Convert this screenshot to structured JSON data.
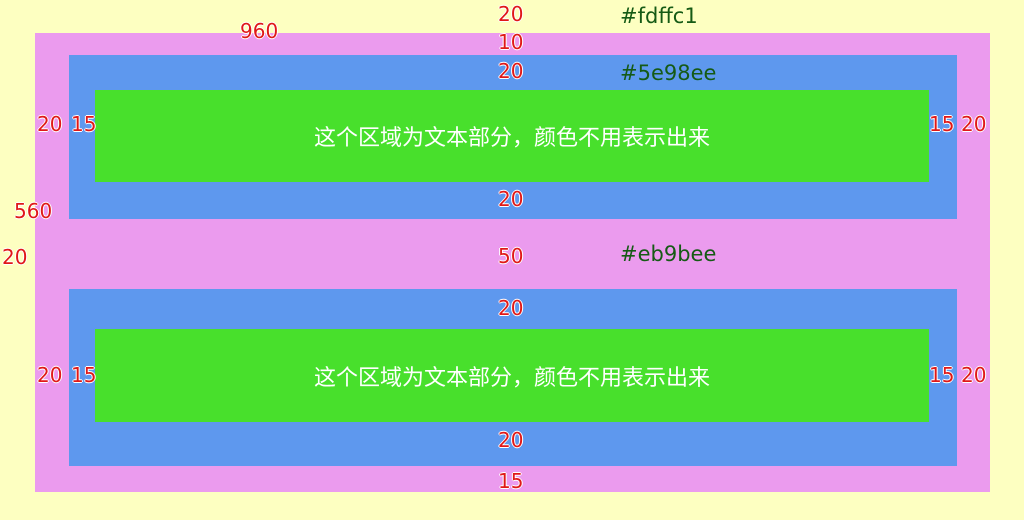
{
  "colors": {
    "page_background": "#fdffc1",
    "outer_container": "#eb9bee",
    "inner_panel": "#5e98ee",
    "text_area": "#48e02c",
    "dimension_text": "#e01818",
    "color_label_text": "#155a15"
  },
  "color_labels": {
    "page": "#fdffc1",
    "panel": "#5e98ee",
    "container": "#eb9bee"
  },
  "text_areas": {
    "top": "这个区域为文本部分，颜色不用表示出来",
    "bottom": "这个区域为文本部分，颜色不用表示出来"
  },
  "dimensions": {
    "container_width": "960",
    "container_height": "560",
    "page_margin_top": "20",
    "page_margin_left": "20",
    "container_padding_top": "10",
    "container_padding_bottom": "15",
    "panel_gap": "50",
    "top_panel": {
      "padding_top": "20",
      "padding_bottom": "20",
      "margin_left": "20",
      "padding_left": "15",
      "padding_right": "15",
      "margin_right": "20"
    },
    "bottom_panel": {
      "padding_top": "20",
      "padding_bottom": "20",
      "margin_left": "20",
      "padding_left": "15",
      "padding_right": "15",
      "margin_right": "20"
    }
  }
}
